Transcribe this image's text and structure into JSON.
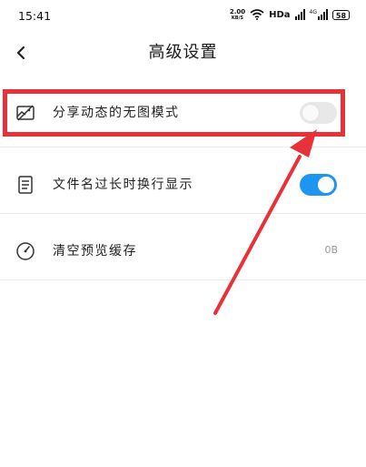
{
  "status_bar": {
    "time": "15:41",
    "speed_value": "2.00",
    "speed_unit": "KB/S",
    "hd": "HDa",
    "signal_label": "4G",
    "battery": "58"
  },
  "header": {
    "title": "高级设置"
  },
  "settings": [
    {
      "label": "分享动态的无图模式",
      "icon": "no-image-icon",
      "control": "toggle",
      "state": "off"
    },
    {
      "label": "文件名过长时换行显示",
      "icon": "document-icon",
      "control": "toggle",
      "state": "on"
    },
    {
      "label": "清空预览缓存",
      "icon": "gauge-icon",
      "control": "value",
      "value": "0B"
    }
  ],
  "colors": {
    "toggle_on": "#1e96f0",
    "toggle_off": "#e8e8e8",
    "annotation": "#e8323a"
  }
}
